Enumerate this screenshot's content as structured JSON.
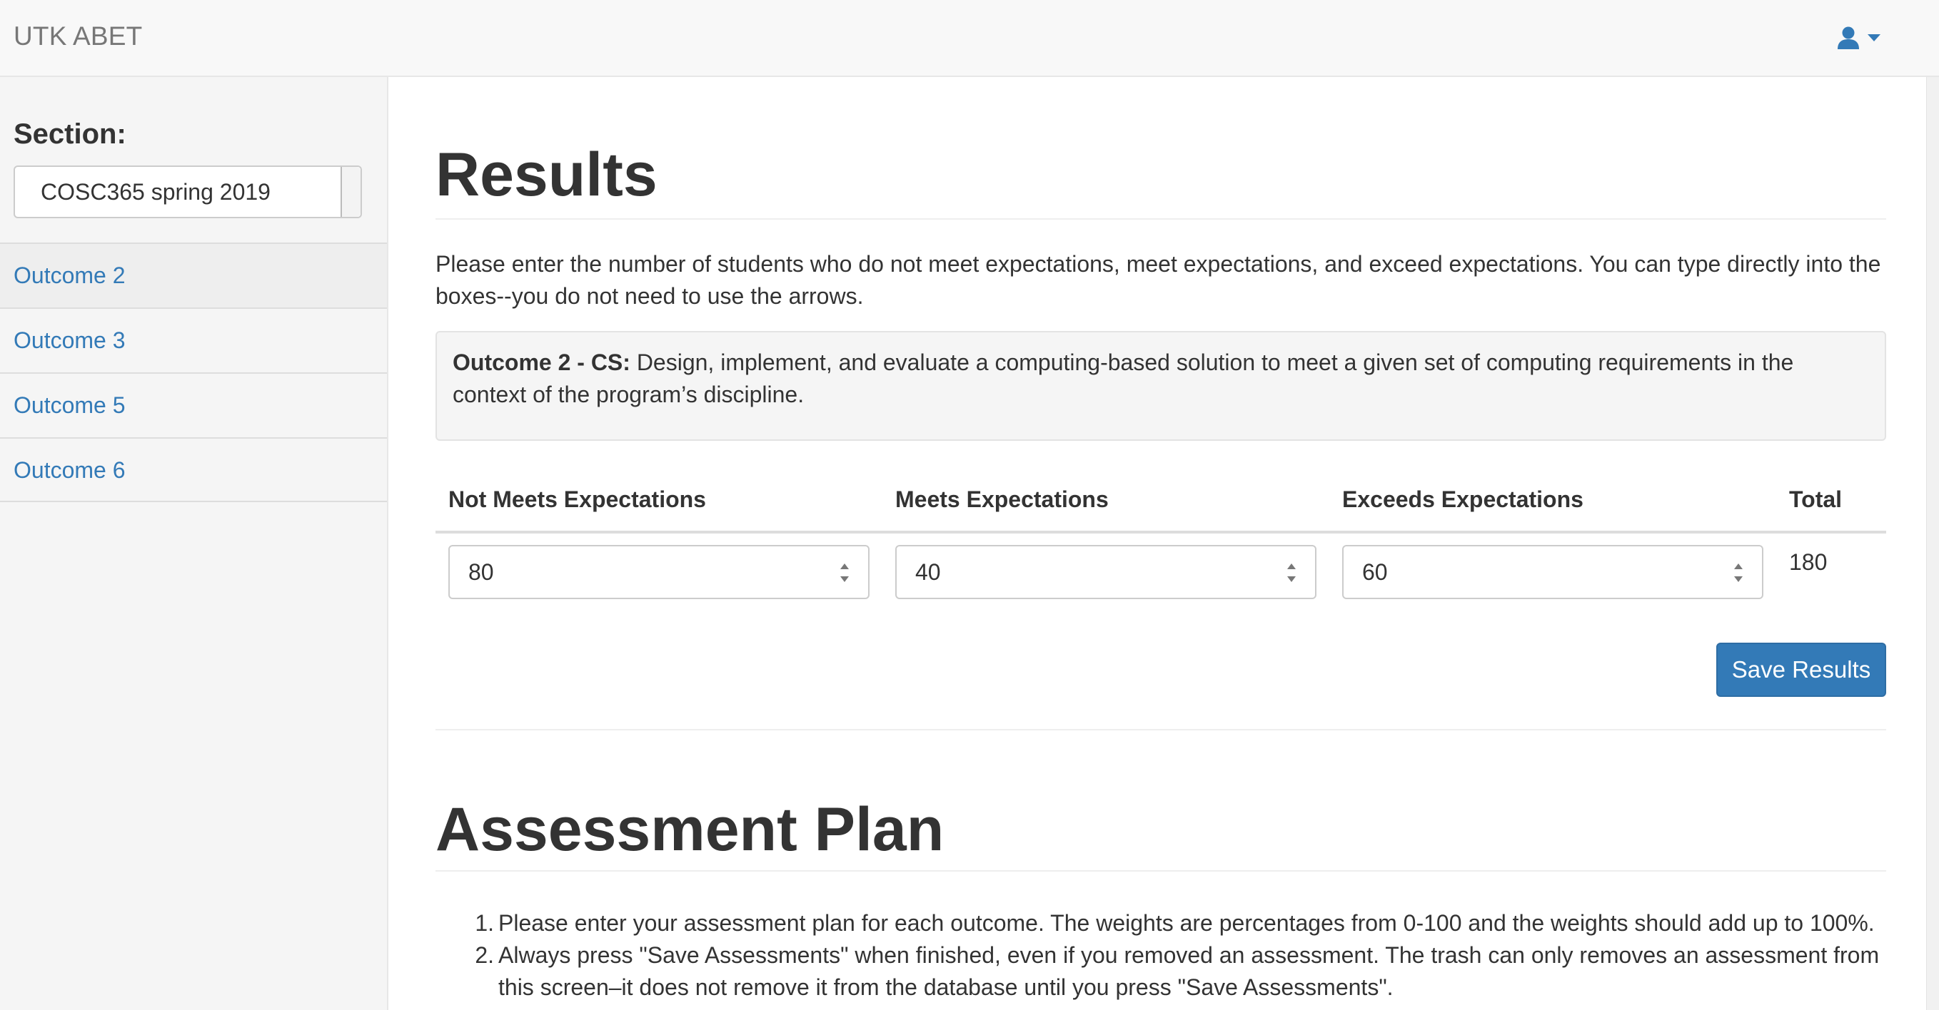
{
  "navbar": {
    "brand": "UTK ABET",
    "user_icon": "user-icon",
    "dropdown_icon": "caret-down-icon"
  },
  "sidebar": {
    "section_label": "Section:",
    "section_select_value": "COSC365 spring 2019",
    "items": [
      {
        "label": "Outcome 2",
        "active": true
      },
      {
        "label": "Outcome 3",
        "active": false
      },
      {
        "label": "Outcome 5",
        "active": false
      },
      {
        "label": "Outcome 6",
        "active": false
      }
    ]
  },
  "results": {
    "title": "Results",
    "intro": "Please enter the number of students who do not meet expectations, meet expectations, and exceed expectations. You can type directly into the boxes--you do not need to use the arrows.",
    "outcome_heading": "Outcome 2 - CS:",
    "outcome_text": " Design, implement, and evaluate a computing-based solution to meet a given set of computing requirements in the context of the program’s discipline.",
    "columns": [
      "Not Meets Expectations",
      "Meets Expectations",
      "Exceeds Expectations",
      "Total"
    ],
    "values": {
      "not_meets": "80",
      "meets": "40",
      "exceeds": "60",
      "total": "180"
    },
    "save_label": "Save Results"
  },
  "assessment_plan": {
    "title": "Assessment Plan",
    "items": [
      "Please enter your assessment plan for each outcome. The weights are percentages from 0-100 and the weights should add up to 100%.",
      "Always press \"Save Assessments\" when finished, even if you removed an assessment. The trash can only removes an assessment from this screen–it does not remove it from the database until you press \"Save Assessments\"."
    ]
  },
  "colors": {
    "accent": "#337ab7",
    "navbar_bg": "#f8f8f8",
    "sidebar_bg": "#f5f5f5",
    "text": "#333333"
  }
}
